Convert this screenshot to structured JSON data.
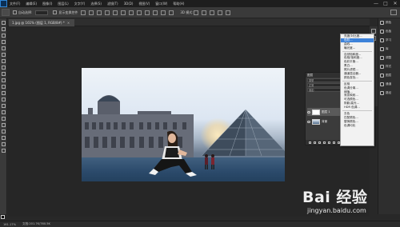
{
  "app": {
    "title": "Adobe Photoshop"
  },
  "menubar": {
    "items": [
      "文件(F)",
      "编辑(E)",
      "图像(I)",
      "图层(L)",
      "文字(Y)",
      "选择(S)",
      "滤镜(T)",
      "3D(D)",
      "视图(V)",
      "窗口(W)",
      "帮助(H)"
    ],
    "window_controls": [
      "—",
      "□",
      "✕"
    ]
  },
  "options_bar": {
    "auto_select_label": "自动选择:",
    "show_transform_label": "显示变换控件",
    "mode_3d_label": "3D 模式:"
  },
  "document_tab": {
    "label": "1.jpg @ 161% (图层 1, RGB/8#) *",
    "close": "×"
  },
  "adjustments_menu": {
    "items": [
      "亮度/对比度...",
      "色阶...",
      "曲线...",
      "曝光度...",
      "自然饱和度...",
      "色相/饱和度...",
      "色彩平衡...",
      "黑白...",
      "照片滤镜...",
      "通道混合器...",
      "颜色查找...",
      "反相",
      "色调分离...",
      "阈值...",
      "渐变映射...",
      "可选颜色...",
      "阴影/高光...",
      "HDR 色调...",
      "去色",
      "匹配颜色...",
      "替换颜色...",
      "色调均化"
    ],
    "highlighted_index": 1
  },
  "layers_panel": {
    "title": "图层",
    "filter_label": "类型",
    "blend_mode": "正常",
    "lock_label": "锁定:",
    "layers": [
      {
        "name": "图层 1"
      },
      {
        "name": "背景"
      }
    ]
  },
  "right_panel": {
    "items": [
      "颜色",
      "色板",
      "学习",
      "库",
      "调整",
      "样式",
      "图层",
      "通道",
      "路径"
    ]
  },
  "status_bar": {
    "zoom": "161.17%",
    "doc_info": "文档:201.7K/760.5K"
  },
  "watermark": {
    "brand": "Bai 经验",
    "url": "jingyan.baidu.com"
  }
}
